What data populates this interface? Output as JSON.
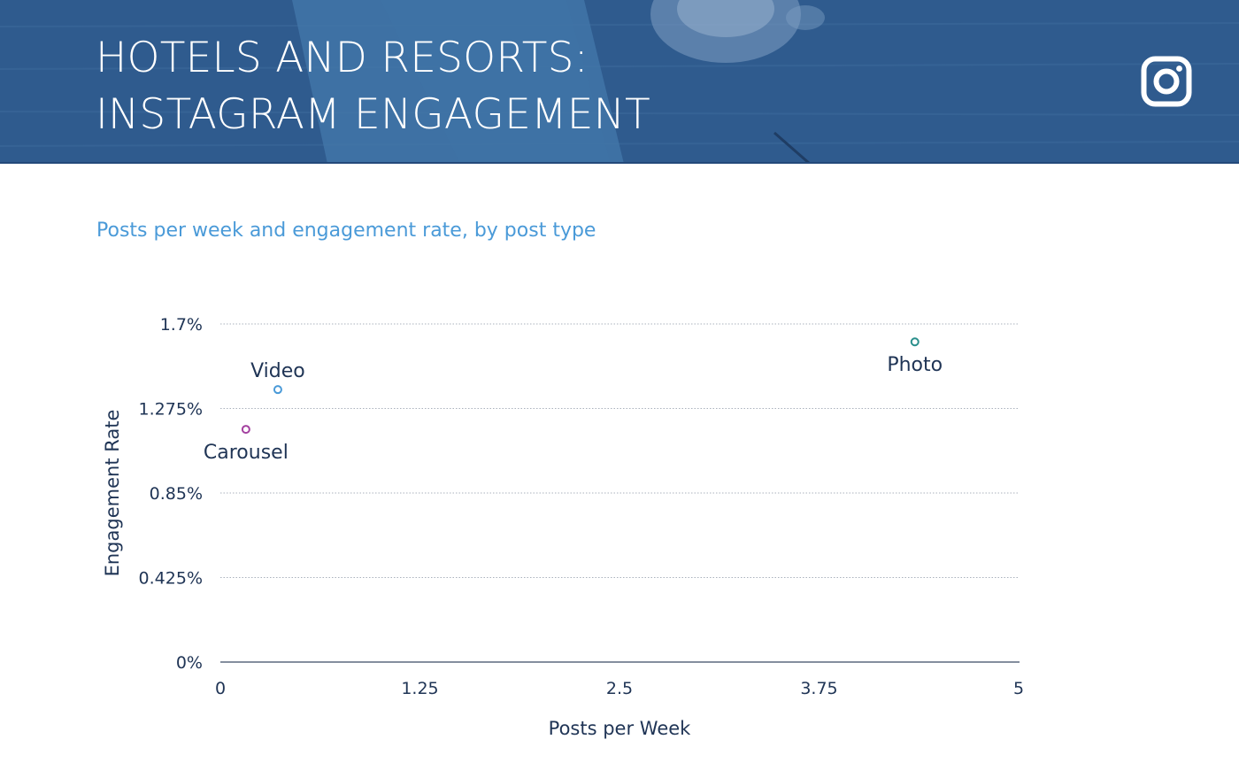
{
  "header": {
    "title_line1": "HOTELS AND RESORTS:",
    "title_line2": "INSTAGRAM ENGAGEMENT",
    "icon": "instagram-icon",
    "background_color": "#2f5b8e"
  },
  "chart_data": {
    "type": "scatter",
    "subtitle": "Posts per week and engagement rate, by post type",
    "xlabel": "Posts per Week",
    "ylabel": "Engagement Rate",
    "xlim": [
      0,
      5
    ],
    "ylim": [
      0,
      1.7
    ],
    "x_ticks": [
      "0",
      "1.25",
      "2.5",
      "3.75",
      "5"
    ],
    "x_tick_values": [
      0,
      1.25,
      2.5,
      3.75,
      5
    ],
    "y_ticks": [
      "0%",
      "0.425%",
      "0.85%",
      "1.275%",
      "1.7%"
    ],
    "y_tick_values": [
      0,
      0.425,
      0.85,
      1.275,
      1.7
    ],
    "grid": true,
    "points": [
      {
        "label": "Video",
        "x": 0.36,
        "y": 1.37,
        "color": "#4a9ad8",
        "label_position": "above"
      },
      {
        "label": "Carousel",
        "x": 0.16,
        "y": 1.17,
        "color": "#a3409f",
        "label_position": "below"
      },
      {
        "label": "Photo",
        "x": 4.35,
        "y": 1.61,
        "color": "#2a8f8c",
        "label_position": "below"
      }
    ]
  }
}
